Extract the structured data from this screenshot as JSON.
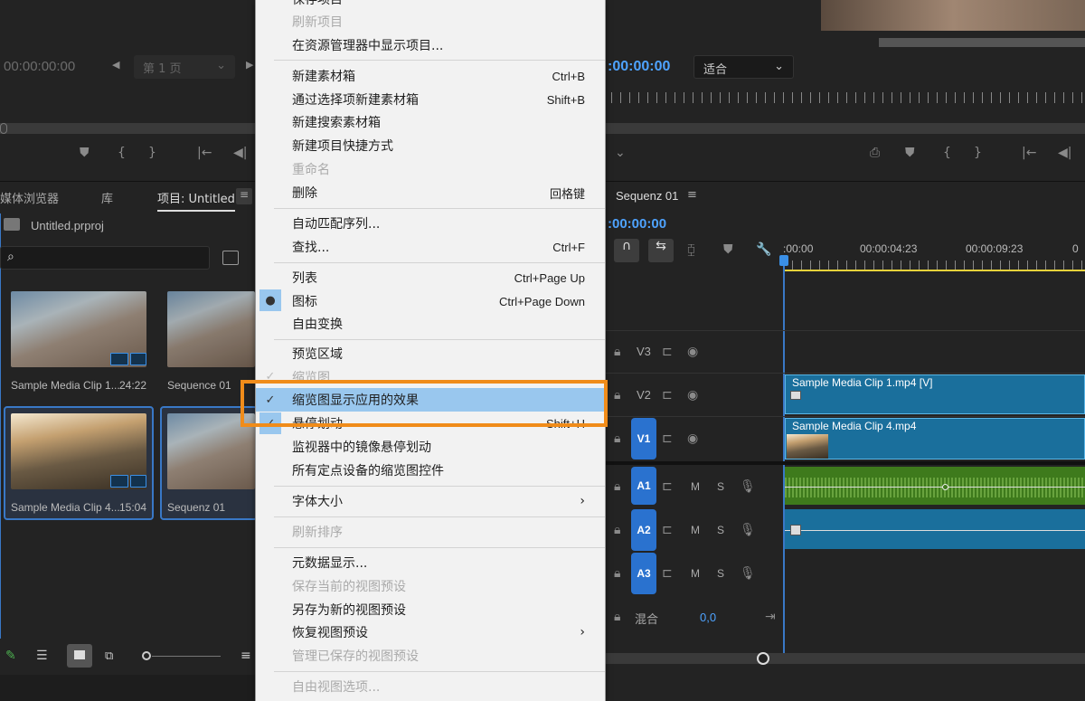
{
  "source_monitor": {
    "timecode": "00:00:00:00",
    "page_select": "第 1 页",
    "controls": [
      "marker-icon",
      "mark-in-icon",
      "mark-out-icon",
      "go-to-in-icon",
      "step-back-icon"
    ]
  },
  "program_monitor": {
    "timecode": ":00:00:00",
    "fit_select": "适合"
  },
  "project_panel": {
    "tabs": [
      {
        "label": "媒体浏览器"
      },
      {
        "label": "库"
      },
      {
        "label": "项目: Untitled"
      }
    ],
    "project_file": "Untitled.prproj",
    "items": [
      {
        "name": "Sample Media Clip 1...",
        "duration": "24:22",
        "selected": false
      },
      {
        "name": "Sequence 01",
        "duration": "",
        "selected": false
      },
      {
        "name": "Sample Media Clip 4...",
        "duration": "15:04",
        "selected": true
      },
      {
        "name": "Sequenz 01",
        "duration": "",
        "selected": true
      }
    ]
  },
  "menu": {
    "items_top": [
      {
        "label": "保存项目",
        "shortcut": "",
        "disabled": false
      },
      {
        "label": "刷新项目",
        "shortcut": "",
        "disabled": true
      },
      {
        "label": "在资源管理器中显示项目...",
        "shortcut": "",
        "disabled": false
      }
    ],
    "group2": [
      {
        "label": "新建素材箱",
        "shortcut": "Ctrl+B"
      },
      {
        "label": "通过选择项新建素材箱",
        "shortcut": "Shift+B"
      },
      {
        "label": "新建搜索素材箱",
        "shortcut": ""
      },
      {
        "label": "新建项目快捷方式",
        "shortcut": ""
      },
      {
        "label": "重命名",
        "shortcut": "",
        "disabled": true
      },
      {
        "label": "删除",
        "shortcut": "回格键"
      }
    ],
    "group3": [
      {
        "label": "自动匹配序列...",
        "shortcut": ""
      },
      {
        "label": "查找...",
        "shortcut": "Ctrl+F"
      }
    ],
    "group4": [
      {
        "label": "列表",
        "shortcut": "Ctrl+Page Up"
      },
      {
        "label": "图标",
        "shortcut": "Ctrl+Page Down",
        "mark": "●"
      },
      {
        "label": "自由变换",
        "shortcut": ""
      }
    ],
    "group5": [
      {
        "label": "预览区域",
        "shortcut": ""
      },
      {
        "label": "缩览图",
        "shortcut": "",
        "disabled": true,
        "mark": "✓"
      },
      {
        "label": "缩览图显示应用的效果",
        "shortcut": "",
        "mark": "✓",
        "highlighted": true
      },
      {
        "label": "悬停划动",
        "shortcut": "Shift+H",
        "mark": "✓"
      },
      {
        "label": "监视器中的镜像悬停划动",
        "shortcut": ""
      },
      {
        "label": "所有定点设备的缩览图控件",
        "shortcut": ""
      }
    ],
    "group6": [
      {
        "label": "字体大小",
        "submenu": true
      }
    ],
    "group7": [
      {
        "label": "刷新排序",
        "disabled": true
      }
    ],
    "group8": [
      {
        "label": "元数据显示...",
        "disabled": false
      },
      {
        "label": "保存当前的视图预设",
        "disabled": true
      },
      {
        "label": "另存为新的视图预设",
        "disabled": false
      },
      {
        "label": "恢复视图预设",
        "disabled": false,
        "submenu": true
      },
      {
        "label": "管理已保存的视图预设",
        "disabled": true
      }
    ],
    "group9": [
      {
        "label": "自由视图选项...",
        "disabled": true
      }
    ]
  },
  "timeline": {
    "sequence_tab": "Sequenz 01",
    "timecode": ":00:00:00",
    "ruler_labels": [
      ":00:00",
      "00:00:04:23",
      "00:00:09:23",
      "0"
    ],
    "tracks": [
      {
        "name": "V3",
        "type": "video"
      },
      {
        "name": "V2",
        "type": "video"
      },
      {
        "name": "V1",
        "type": "video",
        "target": true
      },
      {
        "name": "A1",
        "type": "audio",
        "target": true
      },
      {
        "name": "A2",
        "type": "audio",
        "target": true
      },
      {
        "name": "A3",
        "type": "audio",
        "target": true
      }
    ],
    "track_buttons": {
      "mute": "M",
      "solo": "S"
    },
    "mix": {
      "label": "混合",
      "value": "0,0"
    },
    "clips": [
      {
        "track": "V2",
        "label": "Sample Media Clip 1.mp4 [V]"
      },
      {
        "track": "V1",
        "label": "Sample Media Clip 4.mp4"
      }
    ]
  },
  "colors": {
    "accent_blue": "#3978c6",
    "callout_orange": "#f08c1a",
    "menu_highlight": "#99c7ee",
    "audio_clip_green": "#3e7a1c",
    "video_clip_blue": "#1a6f9c"
  }
}
